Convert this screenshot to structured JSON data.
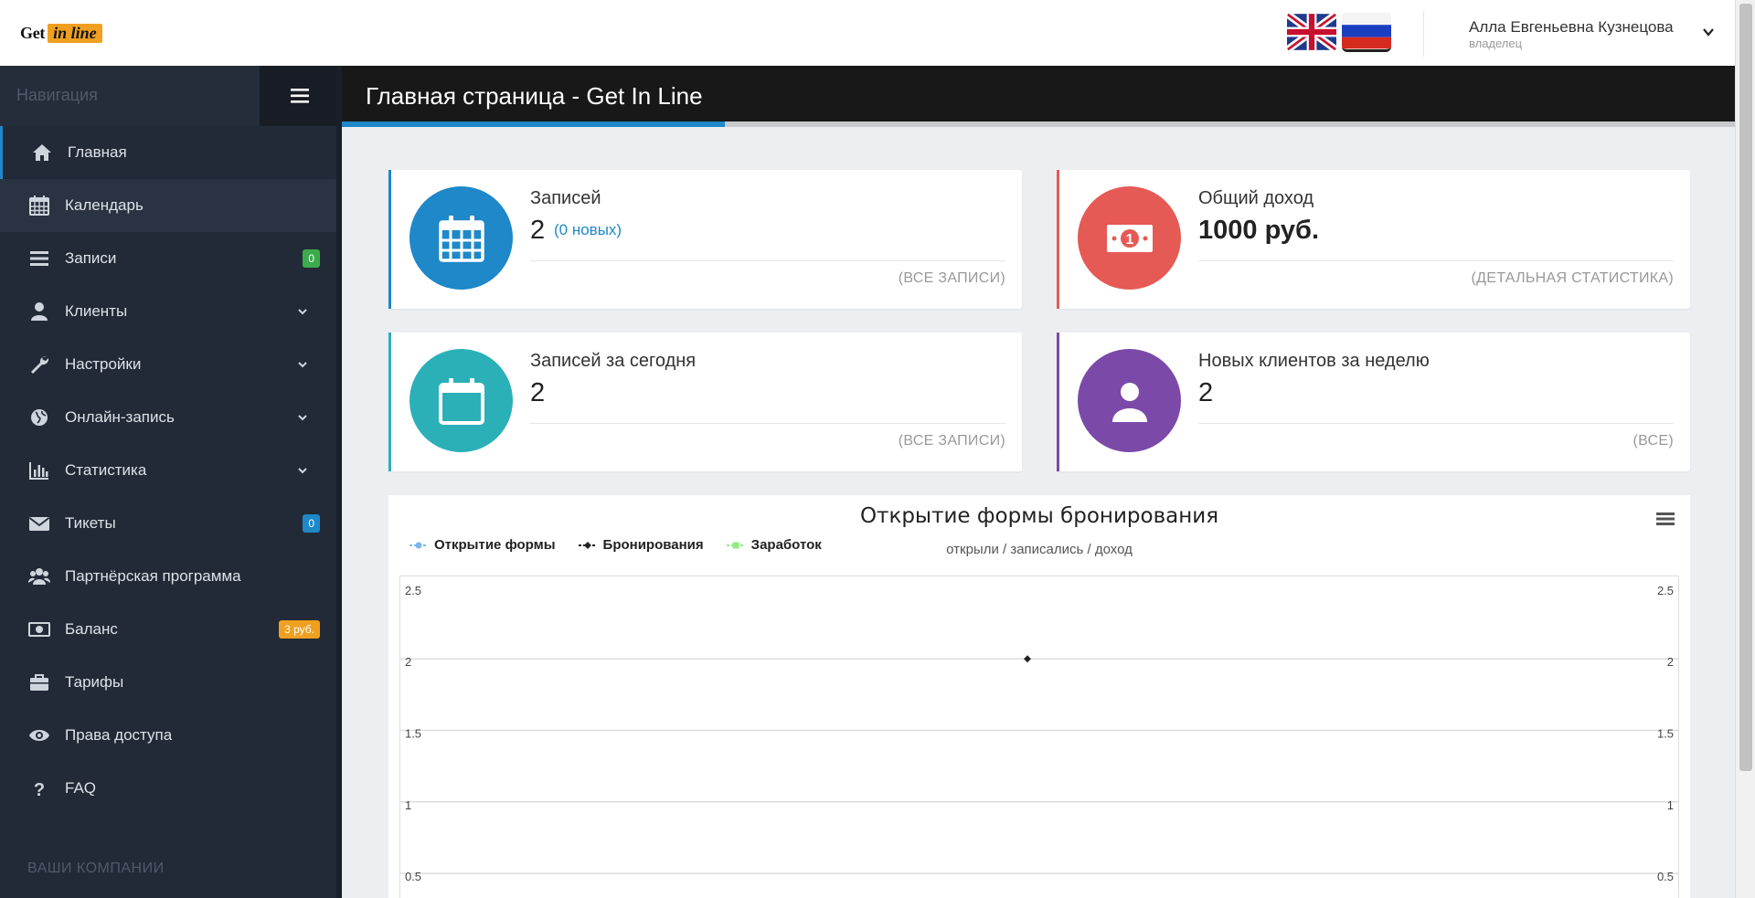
{
  "app": {
    "logo_get": "Get",
    "logo_inline": "in line"
  },
  "header": {
    "languages": [
      "english-flag",
      "russian-flag"
    ],
    "user_name": "Алла Евгеньевна Кузнецова",
    "user_role": "владелец"
  },
  "sidebar": {
    "title": "Навигация",
    "items": [
      {
        "label": "Главная",
        "icon": "home-icon"
      },
      {
        "label": "Календарь",
        "icon": "calendar-icon"
      },
      {
        "label": "Записи",
        "icon": "list-icon",
        "badge": "0"
      },
      {
        "label": "Клиенты",
        "icon": "user-icon"
      },
      {
        "label": "Настройки",
        "icon": "wrench-icon"
      },
      {
        "label": "Онлайн-запись",
        "icon": "globe-icon"
      },
      {
        "label": "Статистика",
        "icon": "bar-chart-icon"
      },
      {
        "label": "Тикеты",
        "icon": "envelope-icon",
        "badge": "0"
      },
      {
        "label": "Партнёрская программа",
        "icon": "users-icon"
      },
      {
        "label": "Баланс",
        "icon": "money-icon",
        "badge": "3 руб."
      },
      {
        "label": "Тарифы",
        "icon": "briefcase-icon"
      },
      {
        "label": "Права доступа",
        "icon": "eye-icon"
      },
      {
        "label": "FAQ",
        "icon": "question-icon"
      }
    ],
    "companies_label": "ВАШИ КОМПАНИИ"
  },
  "page": {
    "title": "Главная страница - Get In Line",
    "progress": 0.275
  },
  "cards": [
    {
      "title": "Записей",
      "value": "2",
      "extra": "(0 новых)",
      "link": "(ВСЕ ЗАПИСИ)",
      "color": "#1e88c8",
      "icon": "calendar-icon"
    },
    {
      "title": "Общий доход",
      "value": "1000 руб.",
      "link": "(ДЕТАЛЬНАЯ СТАТИСТИКА)",
      "color": "#e55a55",
      "icon": "money-icon"
    },
    {
      "title": "Записей за сегодня",
      "value": "2",
      "link": "(ВСЕ ЗАПИСИ)",
      "color": "#2bb0b8",
      "icon": "calendar-empty-icon"
    },
    {
      "title": "Новых клиентов за неделю",
      "value": "2",
      "link": "(ВСЕ)",
      "color": "#7b4aa8",
      "icon": "user-icon"
    }
  ],
  "chart_data": {
    "type": "line",
    "title": "Открытие формы бронирования",
    "subtitle": "открыли / записались / доход",
    "series": [
      {
        "name": "Открытие формы",
        "color": "#7cb5ec",
        "values": []
      },
      {
        "name": "Бронирования",
        "color": "#222222",
        "values": [
          2
        ]
      },
      {
        "name": "Заработок",
        "color": "#90ed7d",
        "values": []
      }
    ],
    "y_ticks": [
      "2.5",
      "2",
      "1.5",
      "1",
      "0.5"
    ],
    "ylim": [
      0,
      2.5
    ],
    "grid": true,
    "legend": "top-left"
  }
}
